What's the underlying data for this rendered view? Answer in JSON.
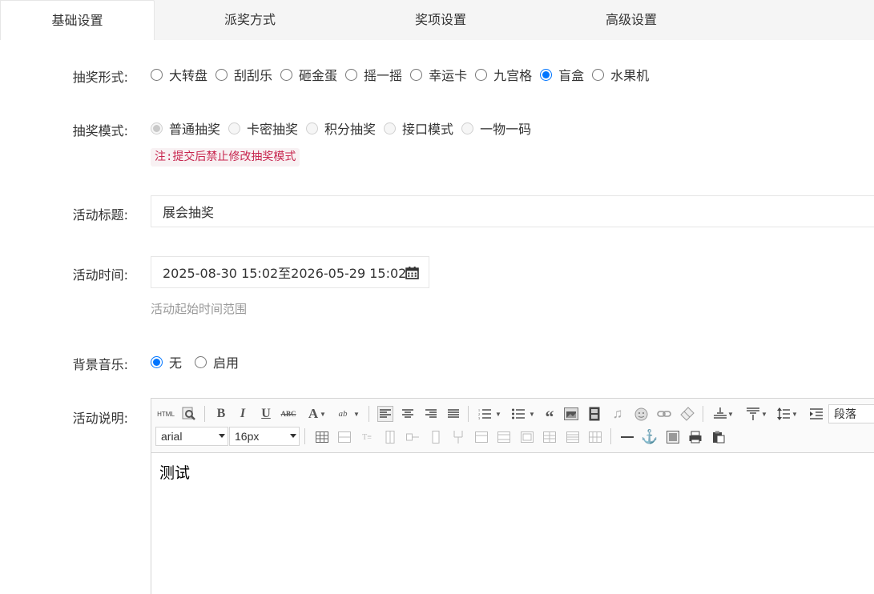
{
  "tabs": [
    {
      "label": "基础设置",
      "active": true
    },
    {
      "label": "派奖方式",
      "active": false
    },
    {
      "label": "奖项设置",
      "active": false
    },
    {
      "label": "高级设置",
      "active": false
    }
  ],
  "lottery_form": {
    "label": "抽奖形式:",
    "options": [
      "大转盘",
      "刮刮乐",
      "砸金蛋",
      "摇一摇",
      "幸运卡",
      "九宫格",
      "盲盒",
      "水果机"
    ],
    "selected": "盲盒"
  },
  "lottery_mode": {
    "label": "抽奖模式:",
    "options": [
      "普通抽奖",
      "卡密抽奖",
      "积分抽奖",
      "接口模式",
      "一物一码"
    ],
    "selected": "普通抽奖",
    "note": "注:提交后禁止修改抽奖模式"
  },
  "activity_title": {
    "label": "活动标题:",
    "value": "展会抽奖"
  },
  "activity_time": {
    "label": "活动时间:",
    "value": "2025-08-30 15:02至2026-05-29 15:02",
    "hint": "活动起始时间范围"
  },
  "bg_music": {
    "label": "背景音乐:",
    "options": [
      "无",
      "启用"
    ],
    "selected": "无"
  },
  "description": {
    "label": "活动说明:",
    "font_family": "arial",
    "font_size": "16px",
    "paragraph": "段落",
    "html_btn": "HTML",
    "content": "测试"
  },
  "colors": {
    "accent": "#0075ff",
    "note_text": "#c7254e",
    "note_bg": "#f8f1f3"
  }
}
